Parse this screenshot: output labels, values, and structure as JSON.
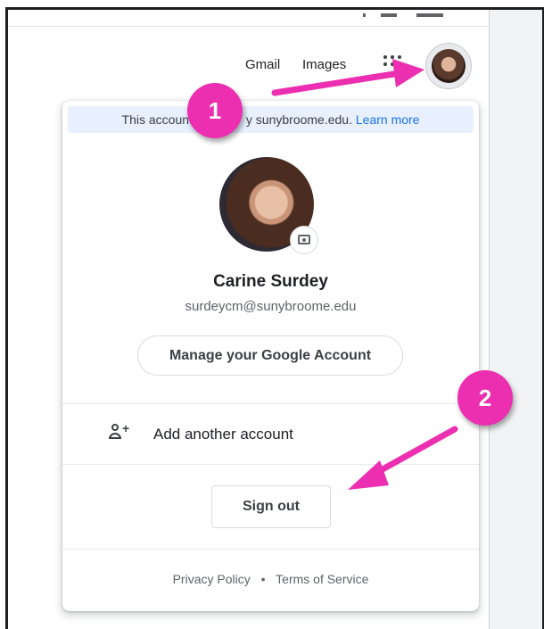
{
  "topbar": {
    "gmail_link": "Gmail",
    "images_link": "Images"
  },
  "account_menu": {
    "managed_banner": {
      "text_before": "This account is",
      "text_after": "y sunybroome.edu.",
      "learn_more": "Learn more"
    },
    "user_name": "Carine Surdey",
    "user_email": "surdeycm@sunybroome.edu",
    "manage_button": "Manage your Google Account",
    "add_account_label": "Add another account",
    "sign_out_button": "Sign out",
    "footer": {
      "privacy": "Privacy Policy",
      "separator": "•",
      "terms": "Terms of Service"
    }
  },
  "annotations": {
    "callout_1": "1",
    "callout_2": "2",
    "arrow_color": "#ec2fb0"
  },
  "icons": [
    "apps-grid-icon",
    "avatar-icon",
    "camera-icon",
    "add-person-icon"
  ],
  "colors": {
    "link": "#1a73e8",
    "banner_bg": "#e8f0fe",
    "callout": "#ec2fb0"
  }
}
